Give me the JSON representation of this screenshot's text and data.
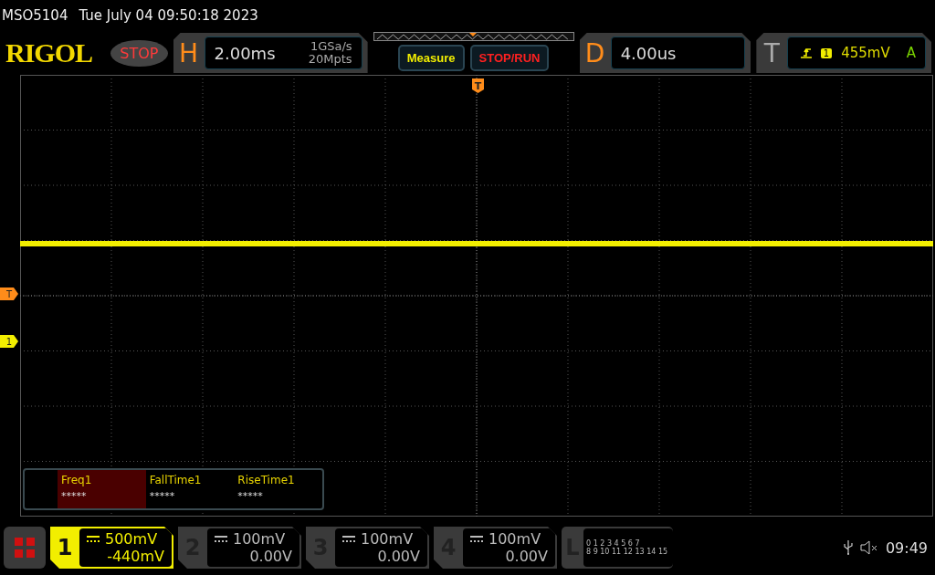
{
  "header": {
    "model": "MSO5104",
    "datetime": "Tue July 04 09:50:18 2023"
  },
  "toolbar": {
    "logo": "RIGOL",
    "run_state": "STOP",
    "horizontal": {
      "letter": "H",
      "scale": "2.00ms",
      "sample_rate": "1GSa/s",
      "memory_depth": "20Mpts"
    },
    "measure_button": "Measure",
    "stop_run_button": "STOP/RUN",
    "delay": {
      "letter": "D",
      "value": "4.00us"
    },
    "trigger": {
      "letter": "T",
      "source": "1",
      "level": "455mV",
      "mode": "A"
    }
  },
  "screen": {
    "trigger_position_marker": "T",
    "left_markers": [
      {
        "label": "T",
        "kind": "trigger"
      },
      {
        "label": "1",
        "kind": "channel"
      }
    ],
    "measurements": [
      {
        "name": "Freq1",
        "value": "*****",
        "selected": true
      },
      {
        "name": "FallTime1",
        "value": "*****",
        "selected": false
      },
      {
        "name": "RiseTime1",
        "value": "*****",
        "selected": false
      }
    ]
  },
  "channels": [
    {
      "number": "1",
      "scale": "500mV",
      "offset": "-440mV",
      "selected": true
    },
    {
      "number": "2",
      "scale": "100mV",
      "offset": "0.00V",
      "selected": false
    },
    {
      "number": "3",
      "scale": "100mV",
      "offset": "0.00V",
      "selected": false
    },
    {
      "number": "4",
      "scale": "100mV",
      "offset": "0.00V",
      "selected": false
    }
  ],
  "logic": {
    "letter": "L",
    "row_1": "0 1 2 3 4 5 6 7",
    "row_2": "8 9 10 11 12 13 14 15"
  },
  "status": {
    "clock": "09:49"
  }
}
